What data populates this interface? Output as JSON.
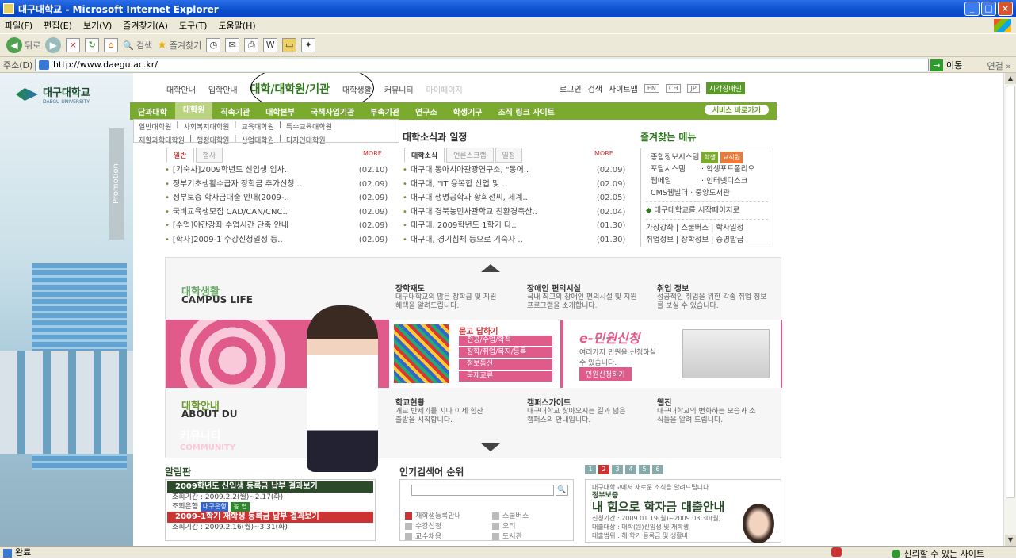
{
  "window": {
    "title": "대구대학교 - Microsoft Internet Explorer"
  },
  "menu": [
    "파일(F)",
    "편집(E)",
    "보기(V)",
    "즐겨찾기(A)",
    "도구(T)",
    "도움말(H)"
  ],
  "toolbar": {
    "back": "뒤로",
    "search": "검색",
    "favorites": "즐겨찾기"
  },
  "address": {
    "label": "주소(D)",
    "url": "http://www.daegu.ac.kr/",
    "go": "이동",
    "links": "연결 »"
  },
  "status": {
    "left": "완료",
    "right": "신뢰할 수 있는 사이트"
  },
  "site": {
    "logo": {
      "name": "대구대학교",
      "sub": "DAEGU UNIVERSITY"
    },
    "promotion": "Promotion",
    "gnav": [
      "대학안내",
      "입학안내",
      "대학/대학원/기관",
      "대학생활",
      "커뮤니티",
      "마이페이지"
    ],
    "util": [
      "로그인",
      "검색",
      "사이트맵",
      "EN",
      "CH",
      "JP",
      "시각장애인"
    ],
    "gbar": [
      "단과대학",
      "대학원",
      "직속기관",
      "대학본부",
      "국책사업기관",
      "부속기관",
      "연구소",
      "학생기구",
      "조직 링크 사이트"
    ],
    "service": "서비스 바로가기",
    "sub": [
      [
        "일반대학원",
        "사회복지대학원",
        "교육대학원",
        "특수교육대학원"
      ],
      [
        "재활과학대학원",
        "행정대학원",
        "산업대학원",
        "디자인대학원"
      ]
    ],
    "notice": {
      "tabs": [
        "일반",
        "행사"
      ],
      "more": "MORE",
      "items": [
        {
          "t": "[기숙사]2009학년도 신입생 입사..",
          "d": "(02.10)"
        },
        {
          "t": "정부기초생활수급자 장학금 추가신청 ..",
          "d": "(02.09)"
        },
        {
          "t": "정부보증 학자금대출 안내(2009-..",
          "d": "(02.09)"
        },
        {
          "t": "국비교육생모집 CAD/CAN/CNC..",
          "d": "(02.09)"
        },
        {
          "t": "[수업]야간강좌 수업시간 단축 안내",
          "d": "(02.09)"
        },
        {
          "t": "[학사]2009-1 수강신청일정 등..",
          "d": "(02.09)"
        }
      ]
    },
    "news": {
      "title": "대학소식과 일정",
      "tabs": [
        "대학소식",
        "언론스크랩",
        "일정"
      ],
      "more": "MORE",
      "items": [
        {
          "t": "대구대 동아시아관광연구소, \"동어..",
          "d": "(02.09)"
        },
        {
          "t": "대구대, \"IT 융복합 산업 및 ..",
          "d": "(02.09)"
        },
        {
          "t": "대구대 생명공학과 황회선씨, 세계..",
          "d": "(02.05)"
        },
        {
          "t": "대구대 경북농민사관학교 친환경축산..",
          "d": "(02.04)"
        },
        {
          "t": "대구대, 2009학년도 1학기 다..",
          "d": "(01.30)"
        },
        {
          "t": "대구대, 경기침체 등으로 기숙사 ..",
          "d": "(01.30)"
        }
      ]
    },
    "fav": {
      "title": "즐겨찾는 메뉴",
      "l1": "종합정보시스템",
      "tag1": "학생",
      "tag2": "교직원",
      "l2": "포탈시스템",
      "l3": "학생포트폴리오",
      "l4": "웹메일",
      "l5": "인터넷디스크",
      "l6": "CMS웹빌더",
      "l7": "중앙도서관",
      "start": "대구대학교를 시작페이지로",
      "b1": "가상강좌 | 스쿨버스 | 학사일정",
      "b2": "취업정보 | 장학정보 | 증명발급"
    },
    "campus": {
      "h": "대학생활",
      "e": "CAMPUS LIFE",
      "i1t": "장학재도",
      "i1d": "대구대학교의 많은 장학금 및 지원혜택을 알려드립니다.",
      "i2t": "장애인 편의시설",
      "i2d": "국내 최고의 장애인 편의시설 및 지원 프로그램을 소개합니다.",
      "i3t": "취업 정보",
      "i3d": "성공적인 취업을 위한 각종 취업 정보를 보실 수 있습니다."
    },
    "community": {
      "h": "커뮤니티",
      "e": "COMMUNITY",
      "qna": "묻고 답하기",
      "b": [
        "전공/수업/학적",
        "장학/취업/복지/등록",
        "정보통신",
        "국제교류"
      ],
      "minwon": "e-민원신청",
      "mdesc": "여러가지 민원을 신청하실 수 있습니다.",
      "mbtn": "민원신청하기"
    },
    "about": {
      "h": "대학안내",
      "e": "ABOUT DU",
      "i1t": "학교현황",
      "i1d": "개교 반세기를 지나 이제 힘찬 출발을 시작합니다.",
      "i2t": "캠퍼스가이드",
      "i2d": "대구대학교 찾아오시는 길과 넓은 캠퍼스의 안내입니다.",
      "i3t": "웹진",
      "i3d": "대구대학교의 변화하는 모습과 소식들을 알려 드립니다."
    },
    "board": {
      "title": "알림판",
      "b1": "2009학년도 신입생 등록금 납부 결과보기",
      "p1": "조회기간 : 2009.2.2(월)~2.17(화)",
      "bank": "조회은행",
      "bk1": "대구은행",
      "bk2": "농 협",
      "b2": "2009-1학기 재학생 등록금 납부 결과보기",
      "p2": "조회기간 : 2009.2.16(월)~3.31(화)"
    },
    "popular": {
      "title": "인기검색어 순위",
      "items": [
        "재학생등록안내",
        "스쿨버스",
        "수강신청",
        "오티",
        "교수채용",
        "도서관"
      ]
    },
    "loan": {
      "pages": [
        "1",
        "2",
        "3",
        "4",
        "5",
        "6"
      ],
      "intro": "대구대학교에서 새로운 소식을 알려드립니다",
      "small": "정부보증",
      "big": "내 힘으로 학자금 대출안내",
      "l1": "신청기간 : 2009.01.19(월)~2009.03.30(월)",
      "l2": "대출대상 : 대학(원)신입생 및 재학생",
      "l3": "대출범위 : 해 학기 등록금 및 생활비"
    }
  }
}
